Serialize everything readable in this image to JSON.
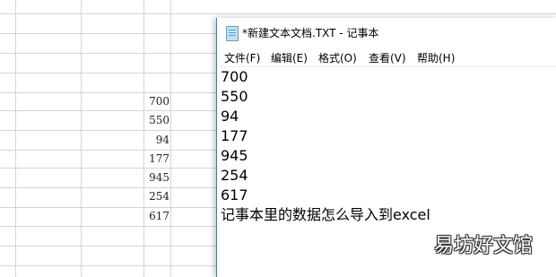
{
  "spreadsheet": {
    "values": [
      "700",
      "550",
      "94",
      "177",
      "945",
      "254",
      "617"
    ]
  },
  "notepad": {
    "title": "*新建文本文档.TXT - 记事本",
    "menu": [
      "文件(F)",
      "编辑(E)",
      "格式(O)",
      "查看(V)",
      "帮助(H)"
    ],
    "lines": [
      "700",
      "550",
      "94",
      "177",
      "945",
      "254",
      "617",
      "记事本里的数据怎么导入到excel"
    ]
  },
  "watermark": "易坊好文馆"
}
